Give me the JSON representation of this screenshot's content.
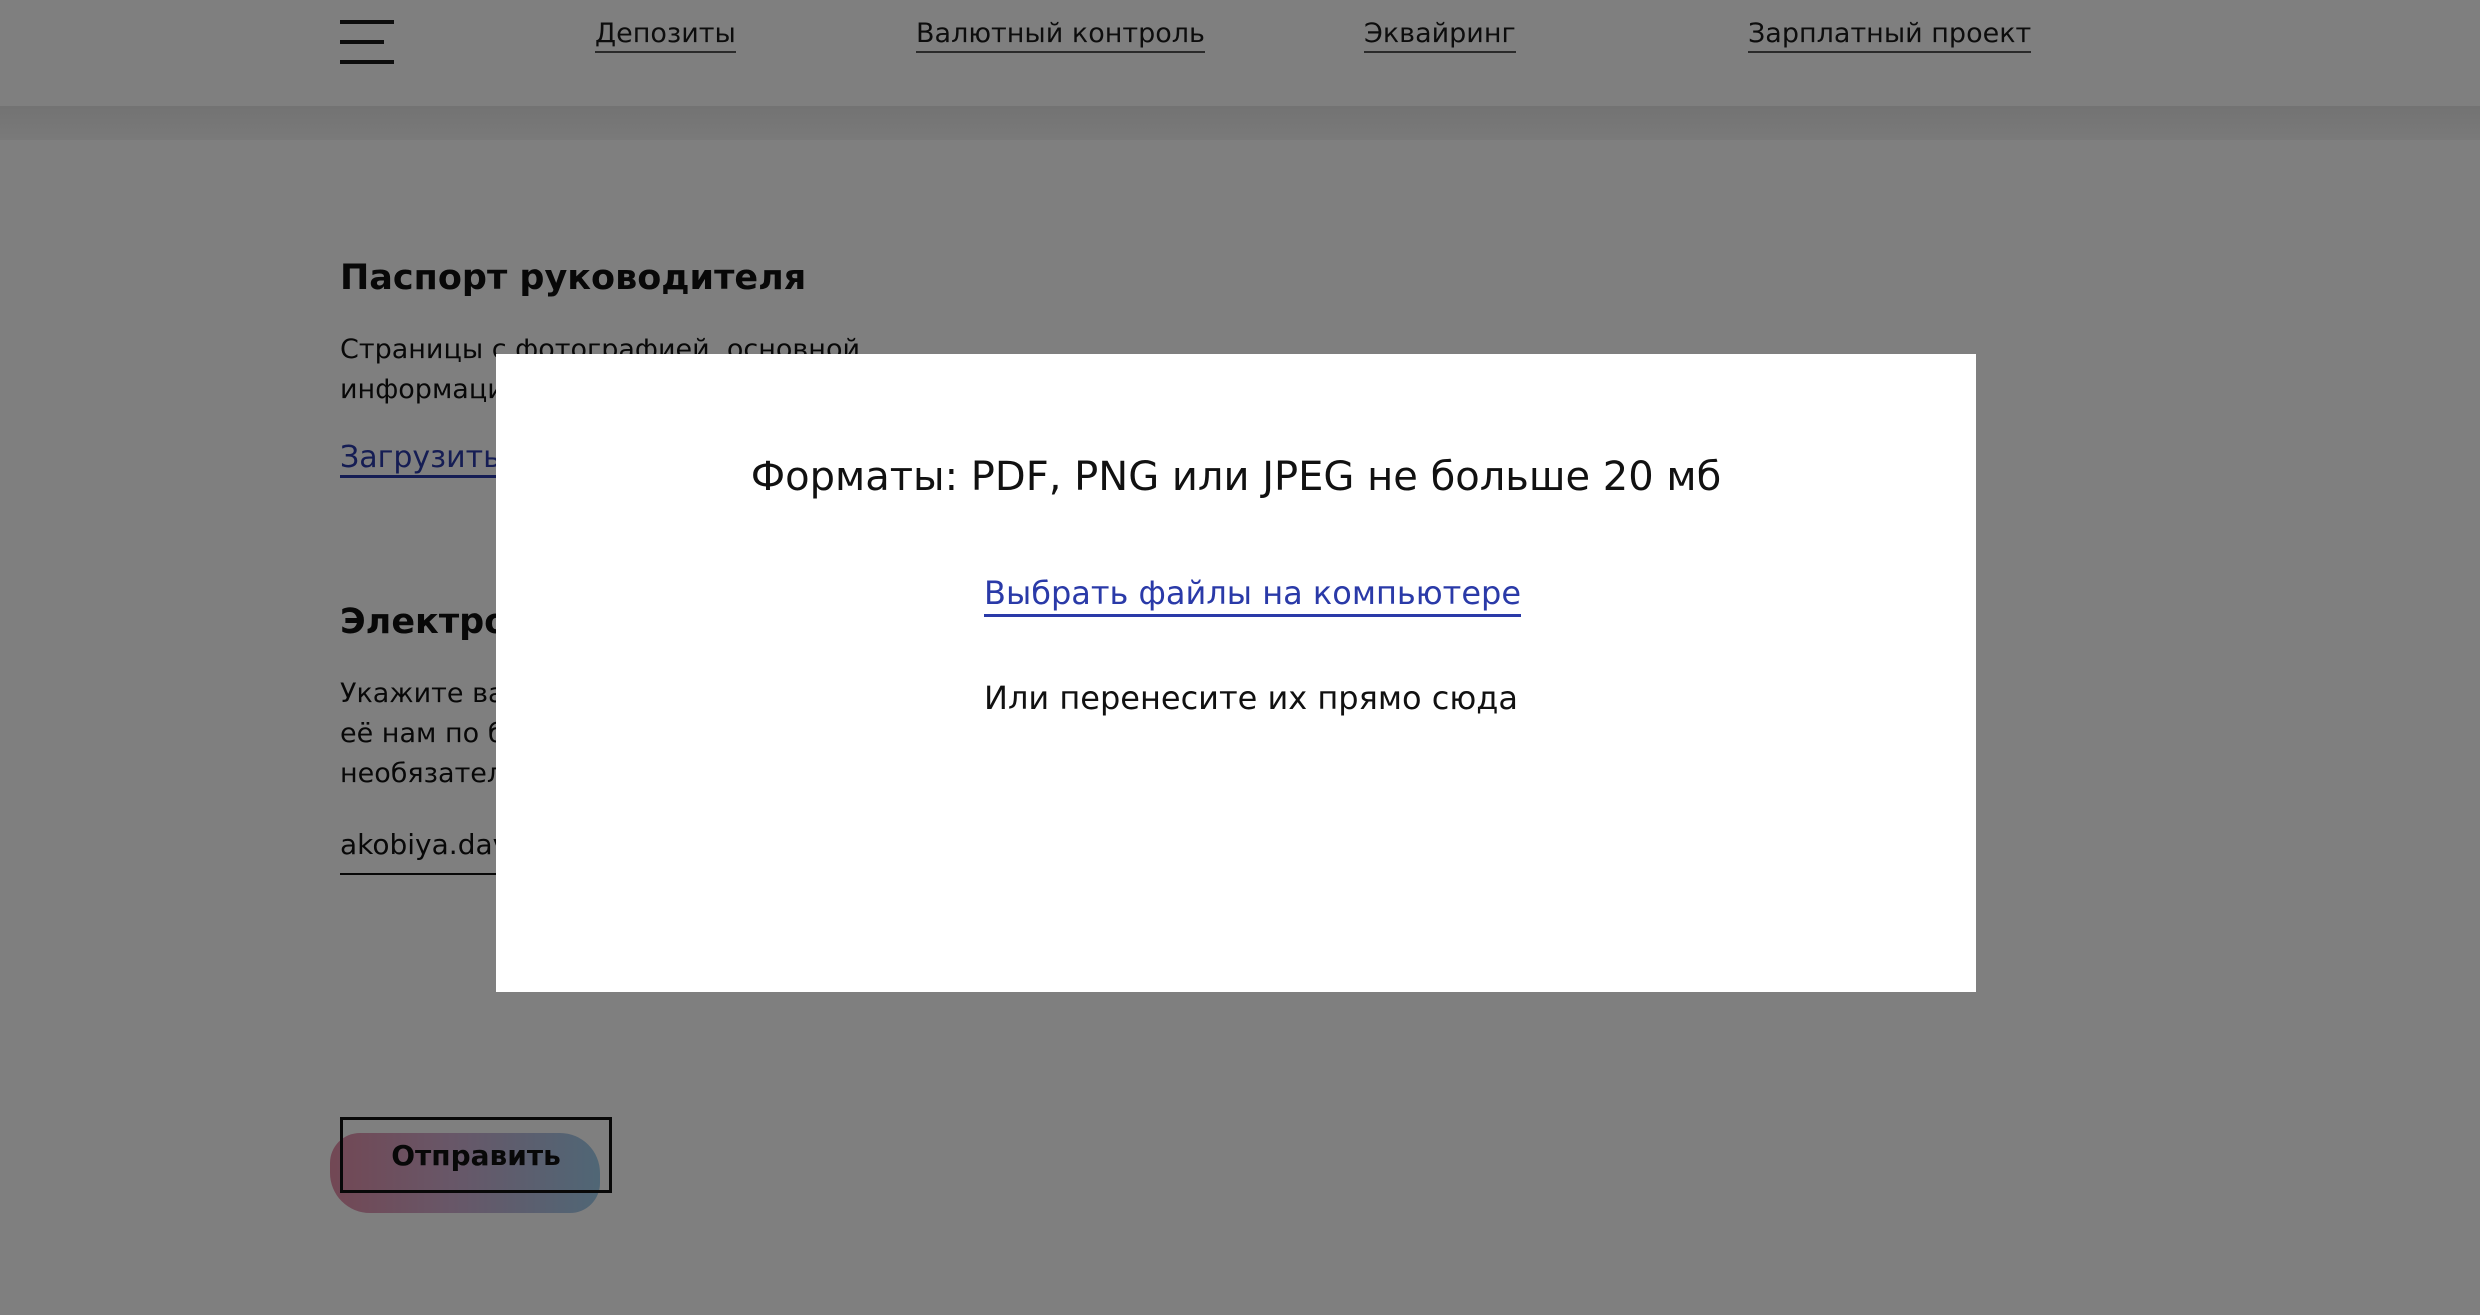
{
  "header": {
    "nav": [
      {
        "label": "Депозиты"
      },
      {
        "label": "Валютный контроль"
      },
      {
        "label": "Эквайринг"
      },
      {
        "label": "Зарплатный проект"
      }
    ]
  },
  "passport": {
    "title": "Паспорт руководителя",
    "desc_line1": "Страницы с фотографией, основной",
    "desc_line2": "информаци",
    "upload_label": "Загрузить"
  },
  "email_section": {
    "title": "Электрон",
    "desc_line1": "Укажите ва",
    "desc_line2": "её нам по б",
    "desc_line3": "необязател",
    "email_value": "akobiya.dav"
  },
  "submit_label": "Отправить",
  "modal": {
    "formats": "Форматы: PDF, PNG или JPEG не больше 20 мб",
    "choose_files": "Выбрать файлы на компьютере",
    "drop_hint": "Или перенесите их прямо сюда"
  },
  "colors": {
    "link": "#2a3aa8",
    "overlay": "rgba(0,0,0,0.5)"
  }
}
